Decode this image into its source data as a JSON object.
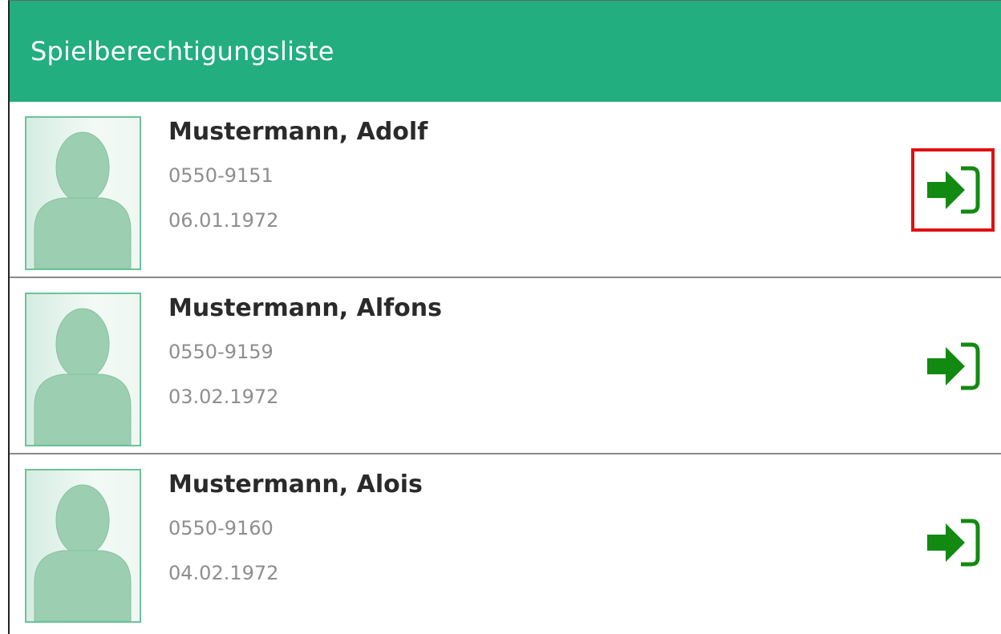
{
  "header": {
    "title": "Spielberechtigungsliste"
  },
  "colors": {
    "header_bg": "#22ae7e",
    "icon_green": "#128a12",
    "highlight": "#e01010"
  },
  "players": [
    {
      "name": "Mustermann, Adolf",
      "number": "0550-9151",
      "birthdate": "06.01.1972",
      "action_icon": "sign-in-icon",
      "highlighted": true
    },
    {
      "name": "Mustermann, Alfons",
      "number": "0550-9159",
      "birthdate": "03.02.1972",
      "action_icon": "sign-in-icon",
      "highlighted": false
    },
    {
      "name": "Mustermann, Alois",
      "number": "0550-9160",
      "birthdate": "04.02.1972",
      "action_icon": "sign-in-icon",
      "highlighted": false
    }
  ]
}
